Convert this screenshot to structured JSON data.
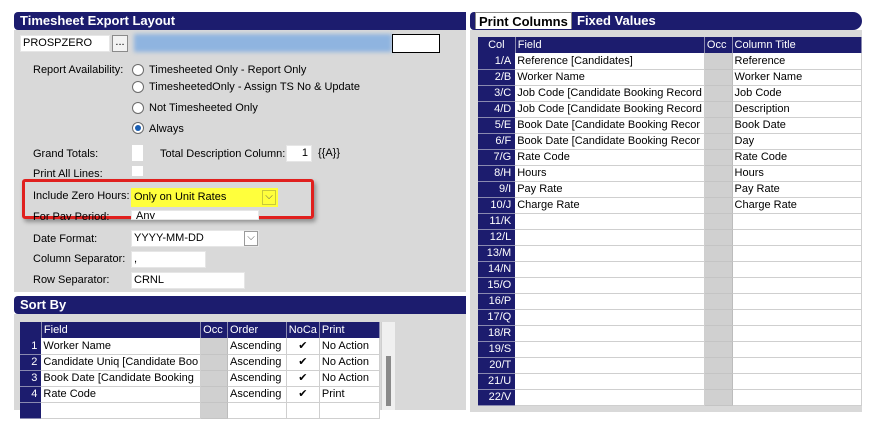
{
  "left_title": "Timesheet Export Layout",
  "code_value": "PROSPZERO",
  "browse_label": "...",
  "labels": {
    "report_availability": "Report Availability:",
    "grand_totals": "Grand Totals:",
    "total_desc_column": "Total Description Column:",
    "print_all_lines": "Print All Lines:",
    "include_zero_hours": "Include Zero Hours:",
    "for_pay_period": "For Pay Period:",
    "date_format": "Date Format:",
    "column_separator": "Column Separator:",
    "row_separator": "Row Separator:"
  },
  "availability_options": [
    "Timesheeted Only - Report Only",
    "TimesheetedOnly - Assign TS No & Update",
    "Not Timesheeted Only",
    "Always"
  ],
  "total_desc_value": "1",
  "total_desc_token": "{{A}}",
  "include_zero_hours_value": "Only on Unit Rates",
  "for_pay_period_value": "Any",
  "date_format_value": "YYYY-MM-DD",
  "column_separator_value": ",",
  "row_separator_value": "CRNL",
  "sort_title": "Sort By",
  "sort_headers": [
    "Field",
    "Occ",
    "Order",
    "NoCa",
    "Print"
  ],
  "sort_rows": [
    {
      "n": "1",
      "field": "Worker Name",
      "order": "Ascending",
      "noca": "✔",
      "print": "No Action"
    },
    {
      "n": "2",
      "field": "Candidate Uniq [Candidate Boo",
      "order": "Ascending",
      "noca": "✔",
      "print": "No Action"
    },
    {
      "n": "3",
      "field": "Book Date [Candidate Booking",
      "order": "Ascending",
      "noca": "✔",
      "print": "No Action"
    },
    {
      "n": "4",
      "field": "Rate Code",
      "order": "Ascending",
      "noca": "✔",
      "print": "Print"
    }
  ],
  "right_tabs": [
    "Print Columns",
    "Fixed Values"
  ],
  "col_headers": [
    "Col",
    "Field",
    "Occ",
    "Column Title"
  ],
  "columns": [
    {
      "col": "1/A",
      "field": "Reference [Candidates]",
      "title": "Reference"
    },
    {
      "col": "2/B",
      "field": "Worker Name",
      "title": "Worker Name"
    },
    {
      "col": "3/C",
      "field": "Job Code [Candidate Booking Record",
      "title": "Job Code"
    },
    {
      "col": "4/D",
      "field": "Job Code [Candidate Booking Record",
      "title": "Description"
    },
    {
      "col": "5/E",
      "field": "Book Date [Candidate Booking Recor",
      "title": "Book Date"
    },
    {
      "col": "6/F",
      "field": "Book Date [Candidate Booking Recor",
      "title": "Day"
    },
    {
      "col": "7/G",
      "field": "Rate Code",
      "title": "Rate Code"
    },
    {
      "col": "8/H",
      "field": "Hours",
      "title": "Hours"
    },
    {
      "col": "9/I",
      "field": "Pay Rate",
      "title": "Pay Rate"
    },
    {
      "col": "10/J",
      "field": "Charge Rate",
      "title": "Charge Rate"
    },
    {
      "col": "11/K",
      "field": "",
      "title": ""
    },
    {
      "col": "12/L",
      "field": "",
      "title": ""
    },
    {
      "col": "13/M",
      "field": "",
      "title": ""
    },
    {
      "col": "14/N",
      "field": "",
      "title": ""
    },
    {
      "col": "15/O",
      "field": "",
      "title": ""
    },
    {
      "col": "16/P",
      "field": "",
      "title": ""
    },
    {
      "col": "17/Q",
      "field": "",
      "title": ""
    },
    {
      "col": "18/R",
      "field": "",
      "title": ""
    },
    {
      "col": "19/S",
      "field": "",
      "title": ""
    },
    {
      "col": "20/T",
      "field": "",
      "title": ""
    },
    {
      "col": "21/U",
      "field": "",
      "title": ""
    },
    {
      "col": "22/V",
      "field": "",
      "title": ""
    }
  ],
  "colors": {
    "header_navy": "#1c1c6e",
    "highlight_yellow": "#ffff3c",
    "callout_red": "#e0201e",
    "selected_radio": "#1a5fb4"
  }
}
